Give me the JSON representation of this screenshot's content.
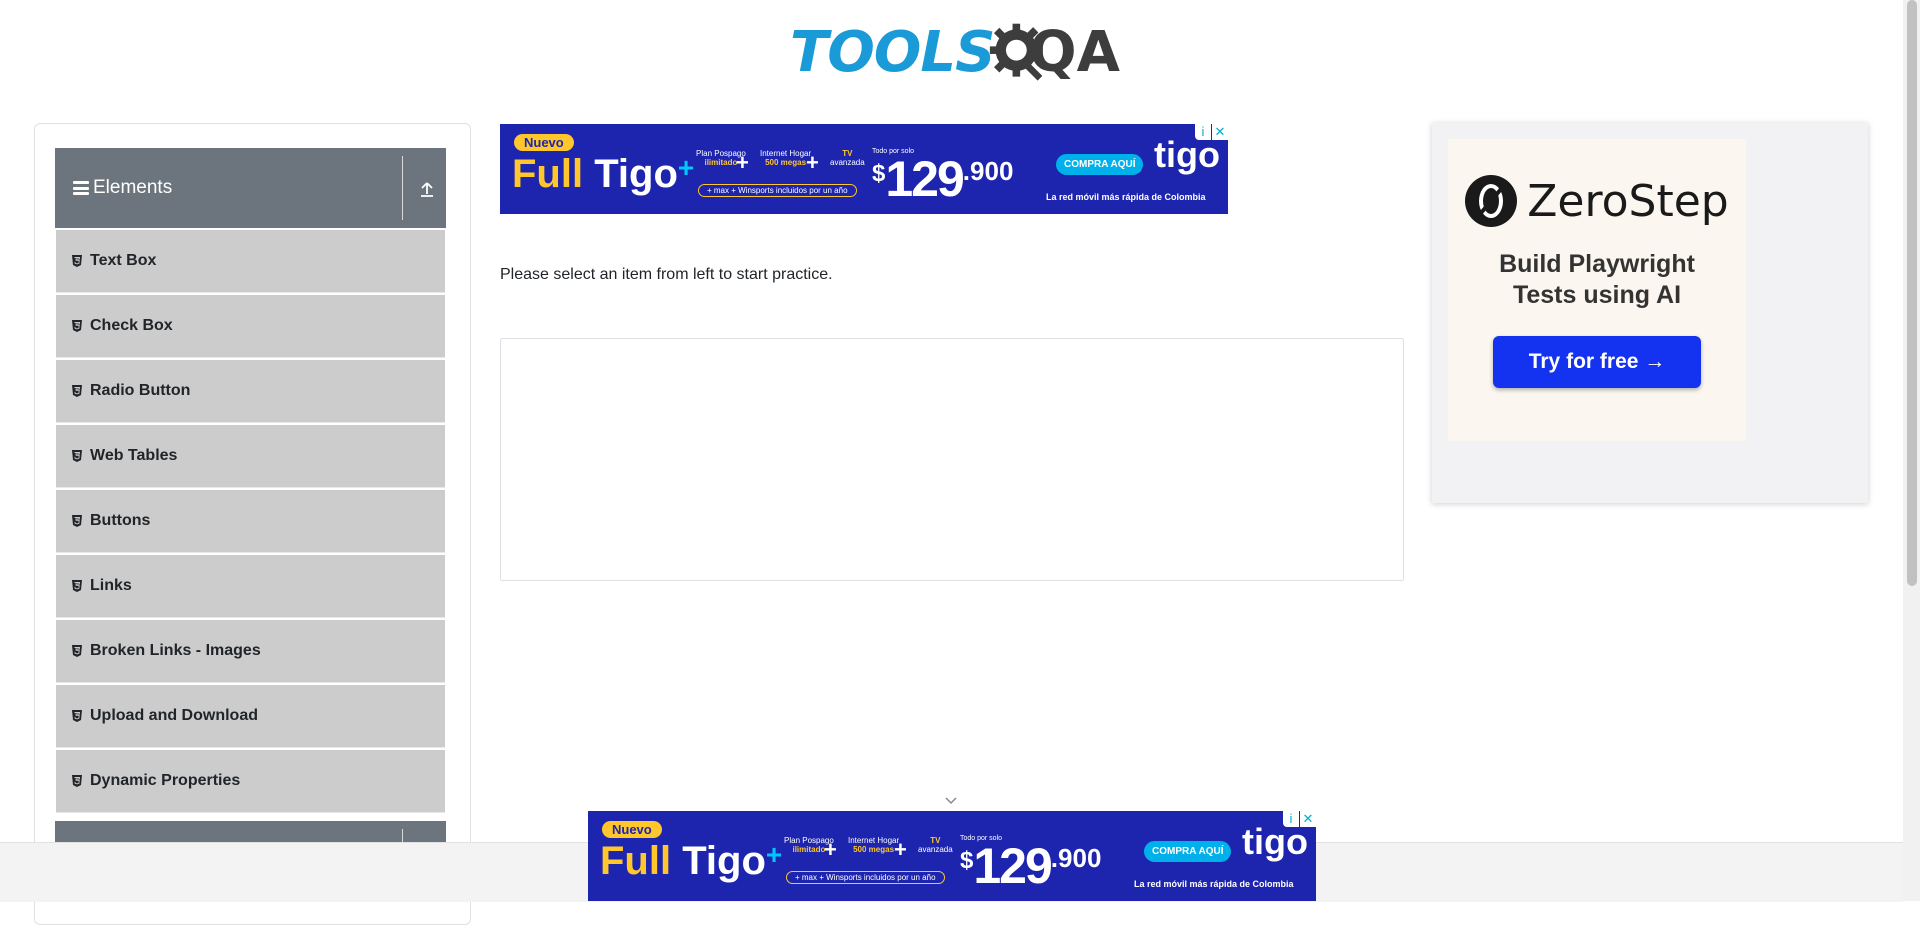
{
  "header": {
    "logo_main": "TOOLS",
    "logo_accent": "QA"
  },
  "sidebar": {
    "group_title": "Elements",
    "items": [
      {
        "label": "Text Box"
      },
      {
        "label": "Check Box"
      },
      {
        "label": "Radio Button"
      },
      {
        "label": "Web Tables"
      },
      {
        "label": "Buttons"
      },
      {
        "label": "Links"
      },
      {
        "label": "Broken Links - Images"
      },
      {
        "label": "Upload and Download"
      },
      {
        "label": "Dynamic Properties"
      }
    ]
  },
  "main": {
    "prompt": "Please select an item from left to start practice."
  },
  "ad_tigo": {
    "badge": "Nuevo",
    "full": "Full",
    "tigo": "Tigo",
    "plus": "+",
    "feat1_a": "Plan Pospago",
    "feat1_b": "ilimitado",
    "feat2_a": "Internet Hogar",
    "feat2_b": "500 megas",
    "feat3_a": "TV",
    "feat3_b": "avanzada",
    "pill": "+ max + Winsports incluidos por un año",
    "todo": "Todo por solo",
    "currency": "$",
    "price_big": "129",
    "price_small": ".900",
    "cta": "COMPRA AQUÍ",
    "brand": "tigo",
    "tagline": "La red móvil más rápida de Colombia",
    "info": "i",
    "close": "✕"
  },
  "ad_zerostep": {
    "brand": "ZeroStep",
    "headline": "Build Playwright Tests using AI",
    "cta": "Try for free →"
  },
  "colors": {
    "brand_blue": "#1a9bd7",
    "group_header": "#6c757d",
    "menu_item": "#cccccc",
    "ad_blue": "#1d24ad",
    "ad_yellow": "#ffc72c",
    "zerostep_cta": "#1433f0"
  },
  "icons": {
    "hamburger": "hamburger-icon",
    "collapse": "collapse-up-icon",
    "menu_item": "html5-icon",
    "scroll_hint": "chevron-down-icon"
  }
}
